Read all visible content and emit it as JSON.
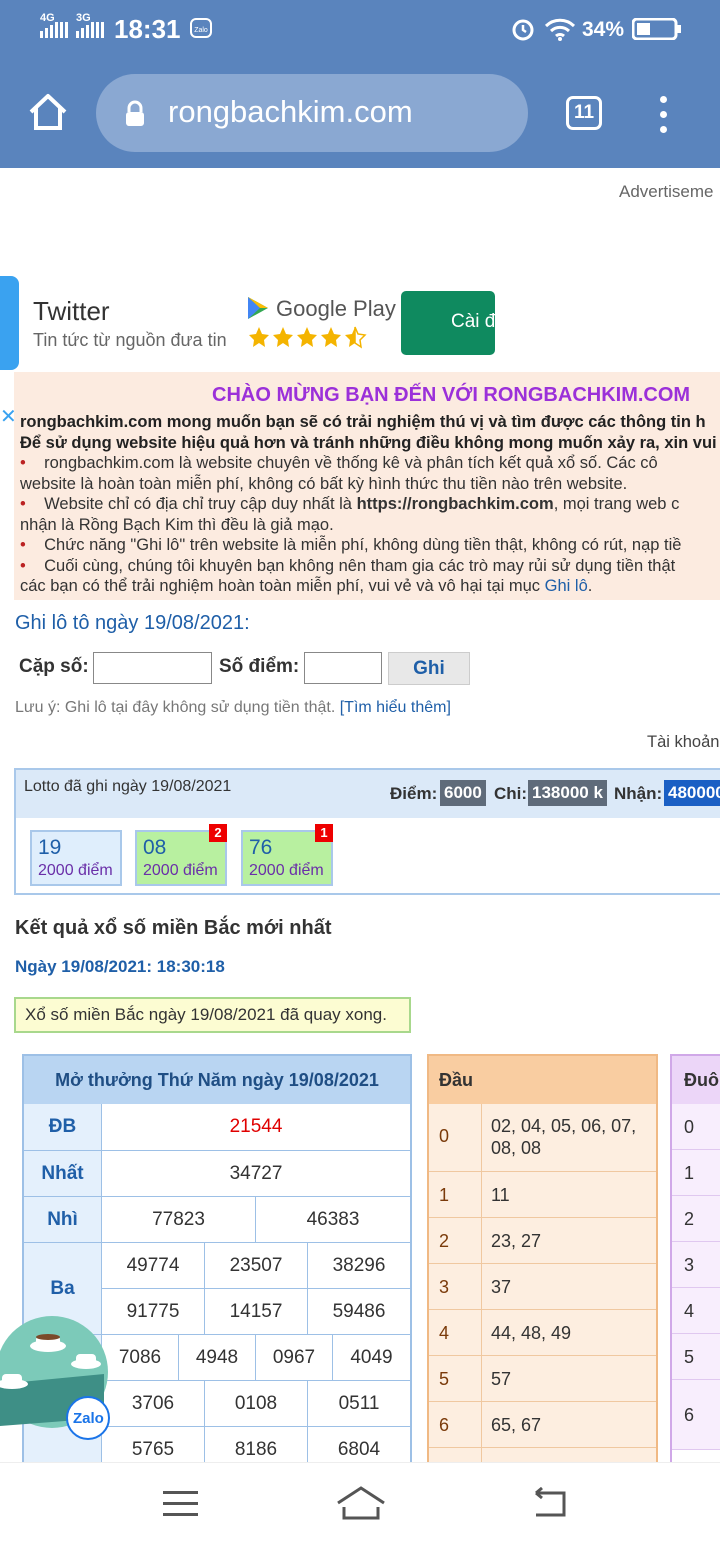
{
  "status_bar": {
    "net1": "4G",
    "net2": "3G",
    "time": "18:31",
    "app_icon": "zalo-icon",
    "battery": "34%"
  },
  "browser": {
    "url": "rongbachkim.com",
    "tab_count": "11",
    "icons": [
      "home-icon",
      "lock-icon",
      "tabs-icon",
      "more-icon"
    ]
  },
  "ad": {
    "label": "Advertiseme",
    "app_name": "Twitter",
    "subtitle": "Tin tức từ nguồn đưa tin",
    "store": "Google Play",
    "install": "Cài đ",
    "rating": 4.5
  },
  "welcome": {
    "close": "✕",
    "title": "CHÀO MỪNG BẠN ĐẾN VỚI RONGBACHKIM.COM",
    "line1": "rongbachkim.com mong muốn bạn sẽ có trải nghiệm thú vị và tìm được các thông tin h",
    "line2": "Để sử dụng website hiệu quả hơn và tránh những điều không mong muốn xảy ra, xin vui lò",
    "b1a": "rongbachkim.com là website chuyên về thống kê và phân tích kết quả xổ số. Các cô",
    "b1b": "website là hoàn toàn miễn phí, không có bất kỳ hình thức thu tiền nào trên website.",
    "b2a": "Website chỉ có địa chỉ truy cập duy nhất là ",
    "b2link": "https://rongbachkim.com",
    "b2c": ", mọi trang web c",
    "b2b": "nhận là Rồng Bạch Kim thì đều là giả mạo.",
    "b3": "Chức năng \"Ghi lô\" trên website là miễn phí, không dùng tiền thật, không có rút, nạp tiề",
    "b4a": "Cuối cùng, chúng tôi khuyên bạn không nên tham gia các trò may rủi sử dụng tiền thật",
    "b4b": "các bạn có thể trải nghiệm hoàn toàn miễn phí, vui vẻ và vô hại tại mục ",
    "b4link": "Ghi lô",
    "b4end": "."
  },
  "ghi_lo": {
    "title": "Ghi lô tô ngày 19/08/2021:",
    "cap_so_label": "Cặp số:",
    "diem_label": "Số điểm:",
    "button": "Ghi",
    "cap_so_value": "",
    "diem_value": "",
    "note": "Lưu ý: Ghi lô tại đây không sử dụng tiền thật. ",
    "note_link": "[Tìm hiểu thêm]",
    "account": "Tài khoản"
  },
  "lotto": {
    "title": "Lotto đã ghi ngày 19/08/2021",
    "diem_label": "Điểm:",
    "diem_value": "6000",
    "chi_label": "Chi:",
    "chi_value": "138000 k",
    "nhan_label": "Nhận:",
    "nhan_value": "480000",
    "picks": [
      {
        "number": "19",
        "points": "2000 điểm",
        "badge": ""
      },
      {
        "number": "08",
        "points": "2000 điểm",
        "badge": "2"
      },
      {
        "number": "76",
        "points": "2000 điểm",
        "badge": "1"
      }
    ]
  },
  "result": {
    "title": "Kết quả xổ số miền Bắc mới nhất",
    "date": "Ngày 19/08/2021: 18:30:18",
    "note": "Xổ số miền Bắc ngày 19/08/2021 đã quay xong.",
    "table_title": "Mở thưởng Thứ Năm ngày 19/08/2021",
    "db_label": "ĐB",
    "db": "21544",
    "nhat_label": "Nhất",
    "nhat": "34727",
    "nhi_label": "Nhì",
    "nhi": [
      "77823",
      "46383"
    ],
    "ba_label": "Ba",
    "ba": [
      "49774",
      "23507",
      "38296",
      "91775",
      "14157",
      "59486"
    ],
    "tu": [
      "7086",
      "4948",
      "0967",
      "4049"
    ],
    "nam": [
      "3706",
      "0108",
      "0511",
      "5765",
      "8186",
      "6804"
    ]
  },
  "dau": {
    "header": "Đầu",
    "rows": [
      {
        "k": "0",
        "v1": "02, 04, 05, 06, 07,",
        "v2": "08, 08"
      },
      {
        "k": "1",
        "v1": "11"
      },
      {
        "k": "2",
        "v1": "23, 27"
      },
      {
        "k": "3",
        "v1": "37"
      },
      {
        "k": "4",
        "v1": "44, 48, 49"
      },
      {
        "k": "5",
        "v1": "57"
      },
      {
        "k": "6",
        "v1": "65, 67"
      }
    ]
  },
  "duoi": {
    "header": "Đuôi",
    "rows": [
      "0",
      "1",
      "2",
      "3",
      "4",
      "5",
      "6"
    ]
  },
  "zalo": {
    "label": "Zalo"
  },
  "nav": {
    "icons": [
      "menu-icon",
      "home-nav-icon",
      "back-icon"
    ]
  },
  "colors": {
    "browser_bar": "#5a84bd",
    "accent_blue": "#1f5fa8",
    "prize_red": "#e00000",
    "welcome_bg": "#fcebe0",
    "welcome_title": "#9b30d9"
  }
}
